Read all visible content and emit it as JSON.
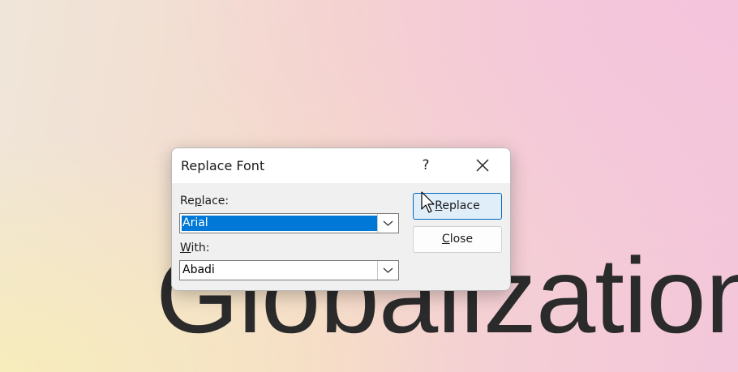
{
  "background_text": "Globalization",
  "dialog": {
    "title": "Replace Font",
    "help_label": "?",
    "replace_label_pre": "Re",
    "replace_label_key": "p",
    "replace_label_post": "lace:",
    "replace_value": "Arial",
    "with_label_key": "W",
    "with_label_post": "ith:",
    "with_value": "Abadi",
    "replace_button_key": "R",
    "replace_button_post": "eplace",
    "close_button_key": "C",
    "close_button_post": "lose"
  },
  "colors": {
    "selection": "#0078d7",
    "primary_button_border": "#0067c0",
    "primary_button_bg": "#e0eefa"
  },
  "icons": [
    "help-icon",
    "close-icon",
    "chevron-down-icon",
    "mouse-pointer-icon"
  ]
}
